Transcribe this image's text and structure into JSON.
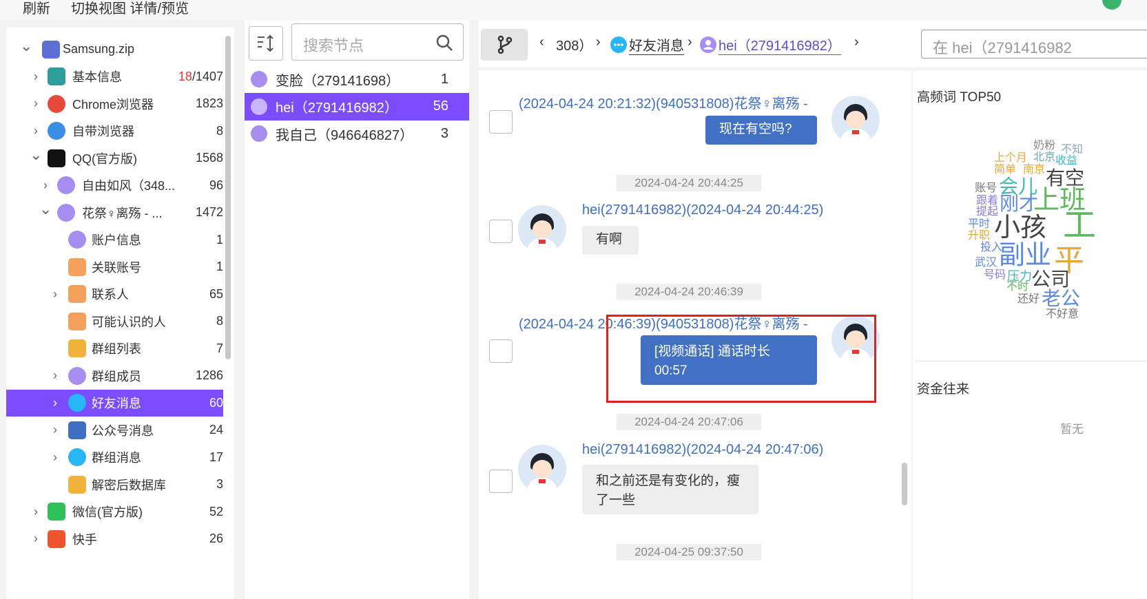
{
  "menu": {
    "refresh": "刷新",
    "switch_view": "切换视图 详情/预览"
  },
  "tree": [
    {
      "label": "Samsung.zip",
      "count": "",
      "level": 0,
      "chevron": "down",
      "icon": "zip-file-icon",
      "color": "#5b6fd6"
    },
    {
      "label": "基本信息",
      "count_red": "18",
      "count": "/1407",
      "level": 1,
      "chevron": "right",
      "icon": "info-card-icon",
      "color": "#2e9e9a"
    },
    {
      "label": "Chrome浏览器",
      "count": "1823",
      "level": 1,
      "chevron": "right",
      "icon": "chrome-icon",
      "color": "#e44b3a"
    },
    {
      "label": "自带浏览器",
      "count": "8",
      "level": 1,
      "chevron": "right",
      "icon": "globe-icon",
      "color": "#3a8ee6"
    },
    {
      "label": "QQ(官方版)",
      "count": "1568",
      "level": 1,
      "chevron": "down",
      "icon": "qq-penguin-icon",
      "color": "#111111"
    },
    {
      "label": "自由如风（348...",
      "count": "96",
      "level": 2,
      "chevron": "right",
      "icon": "user-icon",
      "color": "#a88df0"
    },
    {
      "label": "花祭♀离殇 - ...",
      "count": "1472",
      "level": 2,
      "chevron": "down",
      "icon": "user-icon",
      "color": "#a88df0"
    },
    {
      "label": "账户信息",
      "count": "1",
      "level": 3,
      "chevron": "",
      "icon": "user-icon",
      "color": "#a88df0"
    },
    {
      "label": "关联账号",
      "count": "1",
      "level": 3,
      "chevron": "",
      "icon": "phone-icon",
      "color": "#f5a15c"
    },
    {
      "label": "联系人",
      "count": "65",
      "level": 3,
      "chevron": "right",
      "icon": "phone-icon",
      "color": "#f5a15c"
    },
    {
      "label": "可能认识的人",
      "count": "8",
      "level": 3,
      "chevron": "",
      "icon": "phone-icon",
      "color": "#f5a15c"
    },
    {
      "label": "群组列表",
      "count": "7",
      "level": 3,
      "chevron": "",
      "icon": "group-card-icon",
      "color": "#f2b33d"
    },
    {
      "label": "群组成员",
      "count": "1286",
      "level": 3,
      "chevron": "right",
      "icon": "user-icon",
      "color": "#a88df0"
    },
    {
      "label": "好友消息",
      "count": "60",
      "level": 3,
      "chevron": "right",
      "icon": "chat-bubble-icon",
      "color": "#29b6f6",
      "selected": true
    },
    {
      "label": "公众号消息",
      "count": "24",
      "level": 3,
      "chevron": "right",
      "icon": "official-account-icon",
      "color": "#3f6fc2"
    },
    {
      "label": "群组消息",
      "count": "17",
      "level": 3,
      "chevron": "right",
      "icon": "chat-bubble-icon",
      "color": "#29b6f6"
    },
    {
      "label": "解密后数据库",
      "count": "3",
      "level": 3,
      "chevron": "",
      "icon": "database-icon",
      "color": "#f2b33d"
    },
    {
      "label": "微信(官方版)",
      "count": "52",
      "level": 1,
      "chevron": "right",
      "icon": "wechat-icon",
      "color": "#2fc05a"
    },
    {
      "label": "快手",
      "count": "26",
      "level": 1,
      "chevron": "right",
      "icon": "kuaishou-icon",
      "color": "#f0542d"
    }
  ],
  "search": {
    "placeholder": "搜索节点"
  },
  "contacts": [
    {
      "name": "变脸（279141698）",
      "count": "1"
    },
    {
      "name": "hei（2791416982）",
      "count": "56",
      "selected": true
    },
    {
      "name": "我自己（946646827）",
      "count": "3"
    }
  ],
  "breadcrumb": {
    "part1": "308）",
    "part2": "好友消息",
    "part3": "hei（2791416982）"
  },
  "find": {
    "placeholder": "在 hei（2791416982"
  },
  "messages": [
    {
      "direction": "out",
      "meta": "(2024-04-24 20:21:32)(940531808)花祭♀离殇 -",
      "text": "现在有空吗?"
    },
    {
      "direction": "in",
      "timestamp": "2024-04-24 20:44:25",
      "meta": "hei(2791416982)(2024-04-24 20:44:25)",
      "text": "有啊"
    },
    {
      "direction": "out",
      "timestamp": "2024-04-24 20:46:39",
      "meta": "(2024-04-24 20:46:39)(940531808)花祭♀离殇 -",
      "text": "[视频通话] 通话时长 00:57"
    },
    {
      "direction": "in",
      "timestamp": "2024-04-24 20:47:06",
      "meta": "hei(2791416982)(2024-04-24 20:47:06)",
      "text": "和之前还是有变化的，瘦了一些"
    },
    {
      "direction": "in",
      "timestamp": "2024-04-25 09:37:50"
    }
  ],
  "right_panel": {
    "wordcloud_title": "高频词 TOP50",
    "words": [
      "奶粉",
      "不知",
      "上个月",
      "北京",
      "收益",
      "简单",
      "南京",
      "有空",
      "账号",
      "会儿",
      "跟着",
      "提起",
      "刚才",
      "上班",
      "平时",
      "升职",
      "小孩",
      "工",
      "投入",
      "武汉",
      "副业",
      "平",
      "号码",
      "压力",
      "公司",
      "不时",
      "还好",
      "老公",
      "不好意"
    ],
    "funds_title": "资金往来",
    "funds_empty": "暂无"
  },
  "colors": {
    "accent": "#7c4dff",
    "bubble_out": "#4271c4",
    "highlight": "#e0201f"
  }
}
